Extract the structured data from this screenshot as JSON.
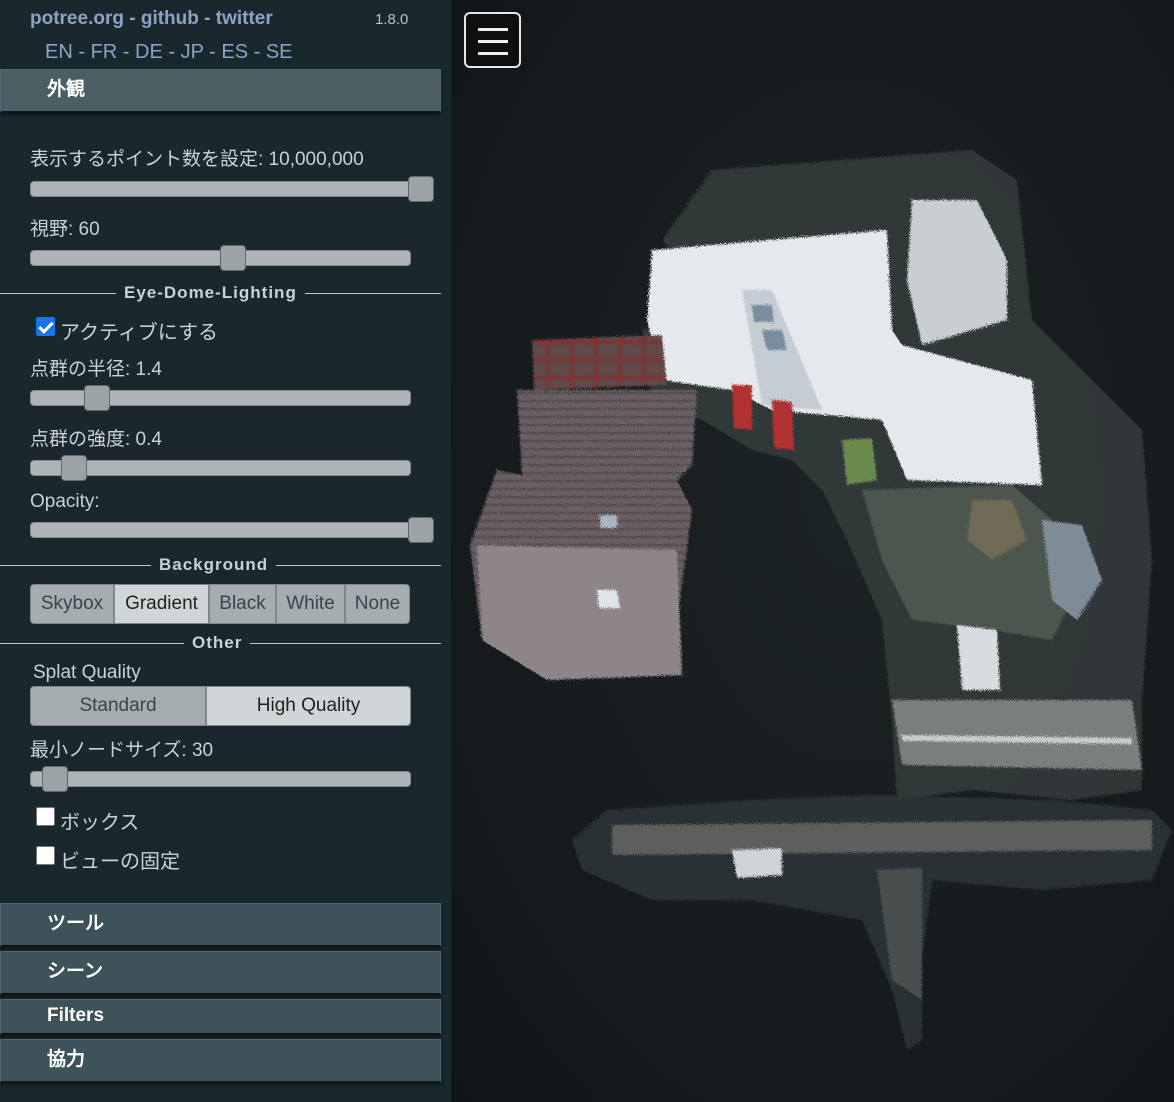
{
  "header": {
    "links": [
      "potree.org",
      "github",
      "twitter"
    ],
    "separator": " - ",
    "version": "1.8.0",
    "languages": [
      "EN",
      "FR",
      "DE",
      "JP",
      "ES",
      "SE"
    ]
  },
  "appearance": {
    "title": "外観",
    "point_budget": {
      "label": "表示するポイント数を設定: 10,000,000",
      "value": 1.0
    },
    "fov": {
      "label": "視野: 60",
      "value": 0.5
    },
    "edl": {
      "title": "Eye-Dome-Lighting",
      "enable_label": "アクティブにする",
      "enabled": true,
      "radius": {
        "label": "点群の半径: 1.4",
        "value": 0.14
      },
      "strength": {
        "label": "点群の強度: 0.4",
        "value": 0.08
      },
      "opacity": {
        "label": "Opacity:",
        "value": 1.0
      }
    },
    "background": {
      "title": "Background",
      "options": [
        "Skybox",
        "Gradient",
        "Black",
        "White",
        "None"
      ],
      "selected": "Gradient"
    },
    "other": {
      "title": "Other",
      "splat_quality_label": "Splat Quality",
      "splat_options": [
        "Standard",
        "High Quality"
      ],
      "splat_selected": "High Quality",
      "min_node_size": {
        "label": "最小ノードサイズ: 30",
        "value": 0.03
      },
      "box_label": "ボックス",
      "box_checked": false,
      "lock_view_label": "ビューの固定",
      "lock_view_checked": false
    }
  },
  "sections": [
    "ツール",
    "シーン",
    "Filters",
    "協力"
  ]
}
